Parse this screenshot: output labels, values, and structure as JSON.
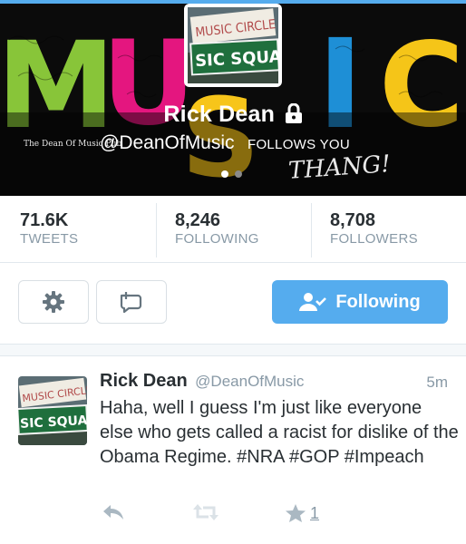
{
  "profile": {
    "name": "Rick Dean",
    "handle": "@DeanOfMusic",
    "follows_you": "FOLLOWS YOU",
    "banner_caption": "The Dean Of Music Pub",
    "banner_script": "THANG!",
    "banner_word": "MUSIC",
    "sign_top": "MUSIC CIRCLE S",
    "sign_bottom": "SIC SQUARE",
    "carousel_pages": 2,
    "carousel_active": 1
  },
  "stats": [
    {
      "value": "71.6K",
      "label": "TWEETS"
    },
    {
      "value": "8,246",
      "label": "FOLLOWING"
    },
    {
      "value": "8,708",
      "label": "FOLLOWERS"
    }
  ],
  "actions": {
    "settings_icon": "gear-icon",
    "reply_icon": "direct-message-icon",
    "follow_label": "Following",
    "follow_icon": "person-check-icon"
  },
  "tweet": {
    "name": "Rick Dean",
    "handle": "@DeanOfMusic",
    "time": "5m",
    "text": "Haha, well I guess I'm just like everyone else who gets called a racist for dislike of the Obama Regime. #NRA #GOP #Impeach",
    "favorite_count": "1"
  },
  "colors": {
    "accent": "#55acee",
    "text": "#292f33",
    "muted": "#8899a6",
    "border": "#e1e8ed"
  }
}
